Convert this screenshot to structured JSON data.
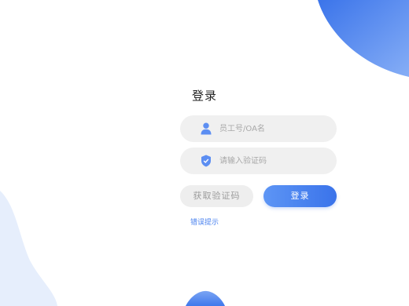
{
  "login": {
    "title": "登录",
    "username_placeholder": "员工号/OA名",
    "code_placeholder": "请输入验证码",
    "get_code_label": "获取验证码",
    "submit_label": "登录",
    "error_hint": "错误提示"
  },
  "icons": {
    "username": "user-icon",
    "code": "shield-icon"
  },
  "colors": {
    "accent": "#3a73ea",
    "accent_light": "#5d95f5",
    "field_bg": "#f0f0f0",
    "hint": "#4a82ef"
  }
}
